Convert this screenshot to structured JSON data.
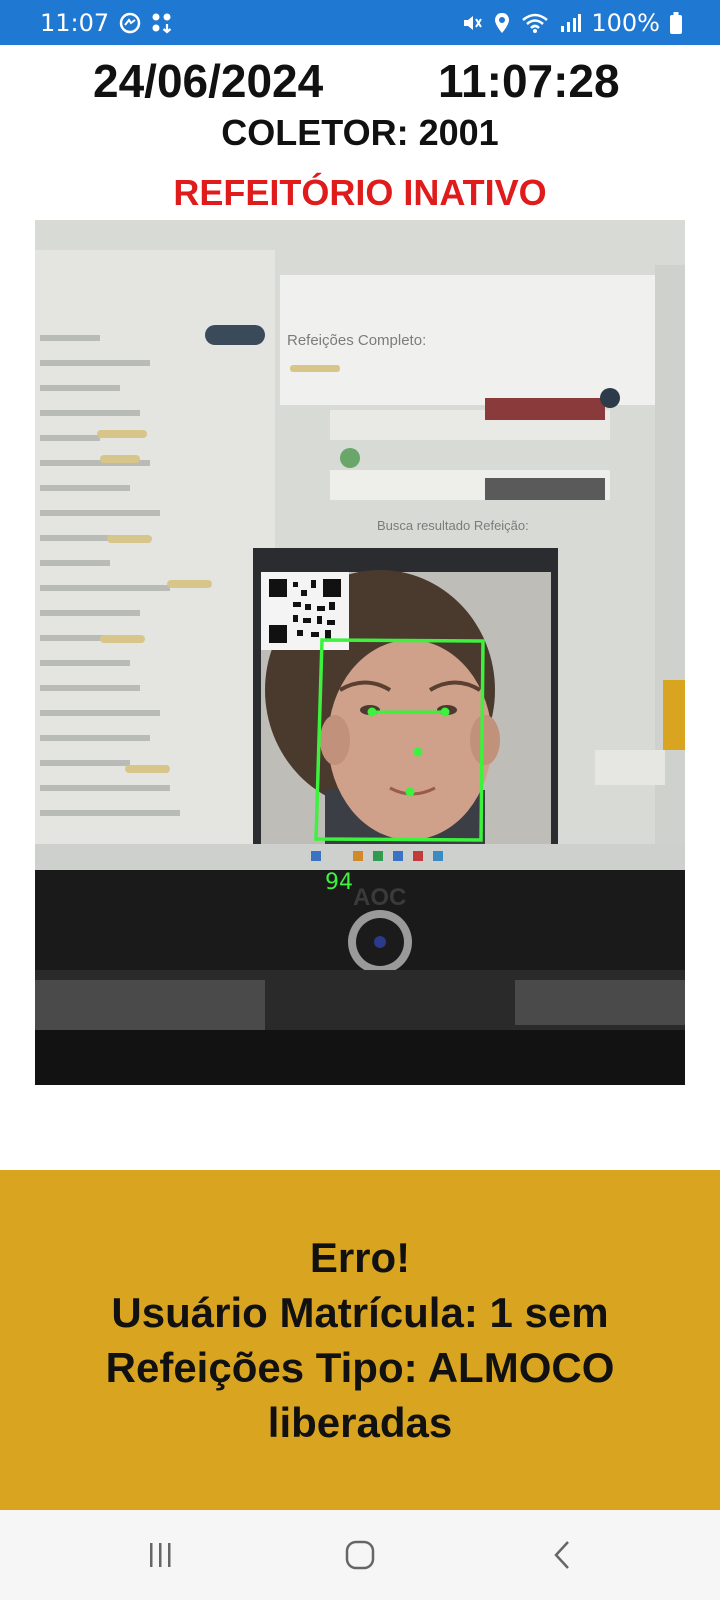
{
  "status_bar": {
    "time": "11:07",
    "battery": "100%",
    "icons_left": [
      "messenger-icon",
      "apps-notification-icon"
    ],
    "icons_right": [
      "mute-vibrate-icon",
      "location-icon",
      "wifi-icon",
      "signal-icon",
      "battery-icon"
    ]
  },
  "header": {
    "date": "24/06/2024",
    "time": "11:07:28",
    "collector": "COLETOR: 2001",
    "status": "REFEITÓRIO INATIVO"
  },
  "camera": {
    "face_confidence": "94",
    "monitor_brand": "AOC",
    "screen_title": "Refeições Completo:",
    "screen_search": "Busca resultado Refeição:"
  },
  "message": {
    "line1": "Erro!",
    "line2": "Usuário Matrícula: 1 sem",
    "line3": "Refeições Tipo: ALMOCO",
    "line4": "liberadas"
  },
  "colors": {
    "status_bar": "#1f78d1",
    "status_text": "#e01b1b",
    "message_bg": "#d9a521",
    "face_box": "#3df23d"
  },
  "nav": {
    "icons": [
      "recent-apps-icon",
      "home-icon",
      "back-icon"
    ]
  }
}
